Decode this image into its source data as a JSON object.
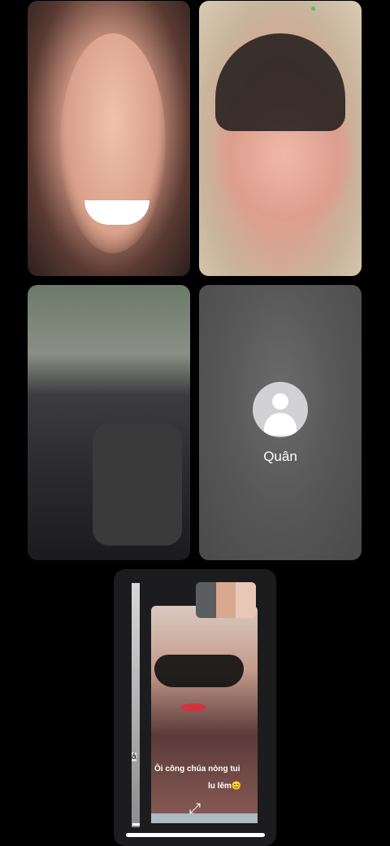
{
  "participants": [
    {
      "id": "p1",
      "type": "video"
    },
    {
      "id": "p2",
      "type": "video"
    },
    {
      "id": "p3",
      "type": "video"
    },
    {
      "id": "p4",
      "type": "avatar",
      "name": "Quân"
    }
  ],
  "pip": {
    "caption_line1": "Ôi công chúa nòng tui",
    "caption_line2": "lu lêm😊",
    "side_label": "á",
    "expand_icon": "expand-arrows-icon"
  },
  "colors": {
    "background": "#000000",
    "avatar_tile": "#575757",
    "avatar_circle": "#d1d1d6",
    "indicator_green": "#2fd158"
  }
}
